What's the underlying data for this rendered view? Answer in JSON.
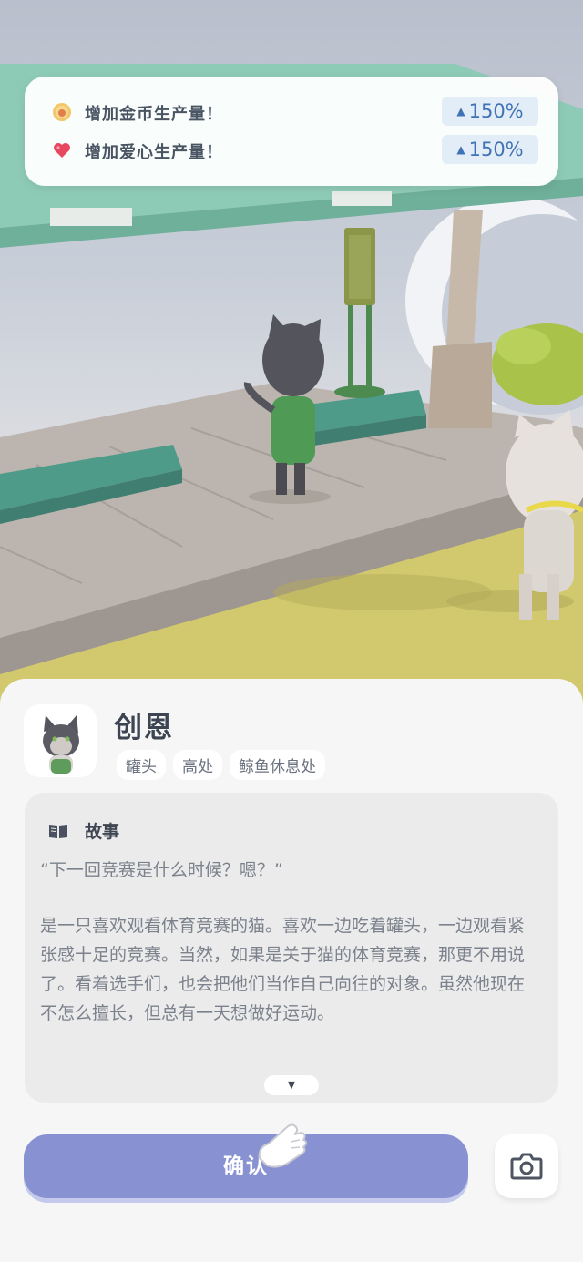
{
  "bonuses": [
    {
      "icon": "coin-icon",
      "label": "增加金币生产量！",
      "value": "150%"
    },
    {
      "icon": "heart-icon",
      "label": "增加爱心生产量！",
      "value": "150%"
    }
  ],
  "cat": {
    "name": "创恩",
    "tags": [
      "罐头",
      "高处",
      "鲸鱼休息处"
    ]
  },
  "story": {
    "title": "故事",
    "quote": "“下一回竞赛是什么时候？嗯？”",
    "body": "是一只喜欢观看体育竞赛的猫。喜欢一边吃着罐头，一边观看紧张感十足的竞赛。当然，如果是关于猫的体育竞赛，那更不用说了。看着选手们，也会把他们当作自己向往的对象。虽然他现在不怎么擅长，但总有一天想做好运动。",
    "more_symbol": "▼"
  },
  "buttons": {
    "confirm": "确认",
    "camera_icon": "camera-icon"
  },
  "colors": {
    "accent": "#8892d2",
    "value_text": "#3f73b6"
  }
}
